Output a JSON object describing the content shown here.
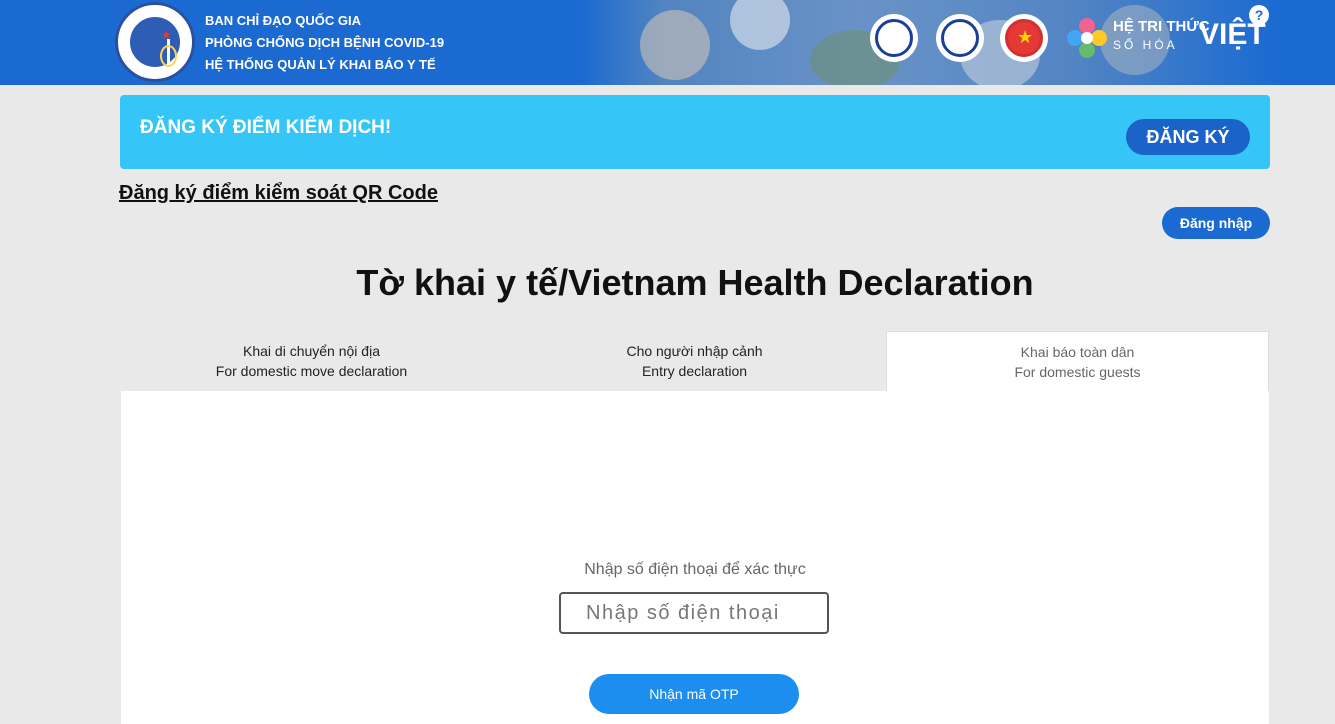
{
  "header": {
    "line1": "BAN CHỈ ĐẠO QUỐC GIA",
    "line2": "PHÒNG CHỐNG DỊCH BỆNH COVID-19",
    "line3": "HỆ THỐNG QUẢN LÝ KHAI BÁO Y TẾ",
    "brand_line1": "HỆ TRI THỨC",
    "brand_line2": "SỐ HÓA",
    "brand_line3": "VIỆT",
    "help_label": "?"
  },
  "banner": {
    "title": "ĐĂNG KÝ ĐIỂM KIỂM DỊCH!",
    "button_label": "ĐĂNG KÝ"
  },
  "qr_link": "Đăng ký điểm kiểm soát QR Code",
  "login_label": "Đăng nhập",
  "page_title": "Tờ khai y tế/Vietnam Health Declaration",
  "tabs": [
    {
      "line1": "Khai di chuyển nội địa",
      "line2": "For domestic move declaration",
      "active": false
    },
    {
      "line1": "Cho người nhập cảnh",
      "line2": "Entry declaration",
      "active": false
    },
    {
      "line1": "Khai báo toàn dân",
      "line2": "For domestic guests",
      "active": true
    }
  ],
  "form": {
    "verify_label": "Nhập số điện thoại để xác thực",
    "phone_placeholder": "Nhập số điện thoại",
    "phone_value": "",
    "otp_button_label": "Nhận mã OTP"
  },
  "colors": {
    "header_bg": "#1a6ad2",
    "banner_bg": "#35c5f6",
    "primary_button": "#1a63c8",
    "otp_button": "#1b8ef0",
    "page_bg": "#e9e9e9"
  }
}
